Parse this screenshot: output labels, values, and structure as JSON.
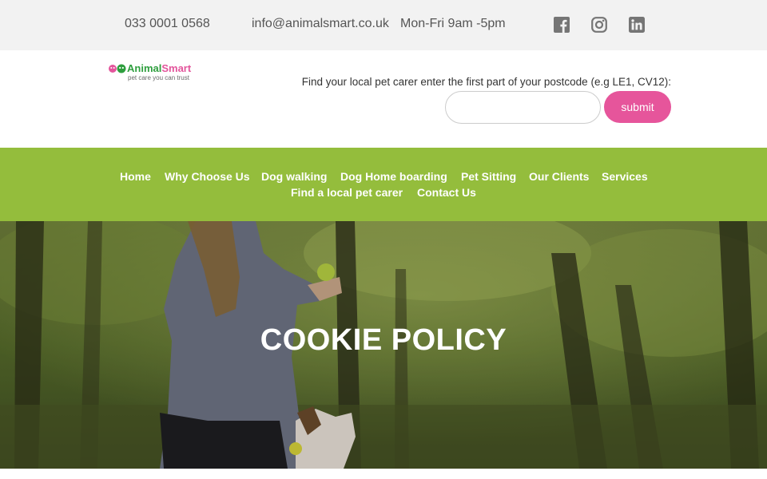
{
  "topbar": {
    "phone": "033 0001 0568",
    "email": "info@animalsmart.co.uk",
    "hours": "Mon-Fri 9am -5pm",
    "social": [
      "facebook-icon",
      "instagram-icon",
      "linkedin-icon"
    ],
    "icon_color": "#757575"
  },
  "logo": {
    "brand_part1": "Animal",
    "brand_part2": "Smart",
    "tagline": "pet care you can trust"
  },
  "search": {
    "label": "Find your local pet carer enter the first part of your postcode (e.g LE1, CV12):",
    "value": "",
    "submit_label": "submit"
  },
  "nav": {
    "items": [
      "Home",
      "Why Choose Us",
      "Dog walking",
      "Dog Home boarding",
      "Pet Sitting",
      "Our Clients",
      "Services",
      "Find a local pet carer",
      "Contact Us"
    ]
  },
  "hero": {
    "title": "COOKIE POLICY"
  },
  "colors": {
    "topbar_bg": "#f2f2f2",
    "nav_bg": "#94bd3c",
    "accent_pink": "#e6559b",
    "brand_green": "#2e9e3e"
  }
}
